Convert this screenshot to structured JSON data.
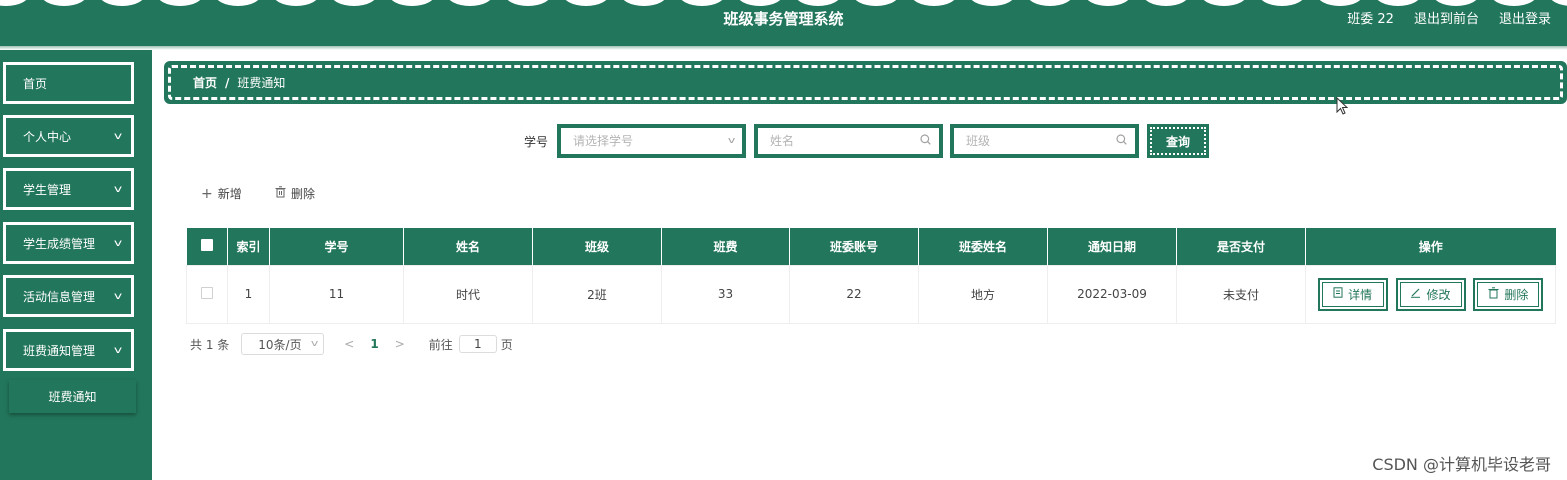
{
  "header": {
    "title": "班级事务管理系统",
    "user": "班委 22",
    "back_to_front": "退出到前台",
    "logout": "退出登录"
  },
  "sidebar": {
    "items": [
      {
        "label": "首页"
      },
      {
        "label": "个人中心"
      },
      {
        "label": "学生管理"
      },
      {
        "label": "学生成绩管理"
      },
      {
        "label": "活动信息管理"
      },
      {
        "label": "班费通知管理"
      }
    ],
    "submenu": "班费通知"
  },
  "breadcrumb": {
    "home": "首页",
    "separator": "/",
    "current": "班费通知"
  },
  "search": {
    "label": "学号",
    "student_id_placeholder": "请选择学号",
    "name_placeholder": "姓名",
    "class_placeholder": "班级",
    "query_button": "查询"
  },
  "actions": {
    "add": "新增",
    "delete": "删除"
  },
  "table": {
    "columns": [
      "索引",
      "学号",
      "姓名",
      "班级",
      "班费",
      "班委账号",
      "班委姓名",
      "通知日期",
      "是否支付",
      "操作"
    ],
    "rows": [
      {
        "index": "1",
        "student_id": "11",
        "name": "时代",
        "class": "2班",
        "fee": "33",
        "monitor_account": "22",
        "monitor_name": "地方",
        "notice_date": "2022-03-09",
        "paid": "未支付"
      }
    ],
    "ops": {
      "detail": "详情",
      "edit": "修改",
      "delete": "删除"
    }
  },
  "pagination": {
    "total": "共 1 条",
    "page_size": "10条/页",
    "current_page": "1",
    "goto_label": "前往",
    "goto_value": "1",
    "page_unit": "页"
  },
  "watermark": "CSDN @计算机毕设老哥",
  "colors": {
    "primary": "#22765b",
    "background": "#ffffff"
  }
}
